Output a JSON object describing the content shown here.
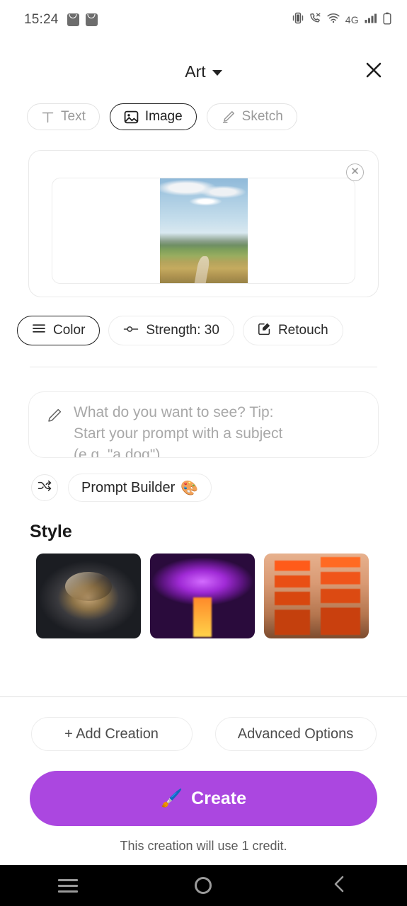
{
  "status_bar": {
    "time": "15:24",
    "left_icons": [
      "mail-bag-icon",
      "mail-bag-icon"
    ],
    "network_label": "4G",
    "right_icons": [
      "vibrate-icon",
      "call-mute-icon",
      "wifi-icon",
      "signal-bars-icon",
      "battery-icon"
    ]
  },
  "header": {
    "title": "Art",
    "dropdown_icon": "chevron-down-icon",
    "close_icon": "close-icon"
  },
  "modes": [
    {
      "label": "Text",
      "icon": "text-t-icon",
      "active": false
    },
    {
      "label": "Image",
      "icon": "image-icon",
      "active": true
    },
    {
      "label": "Sketch",
      "icon": "pencil-icon",
      "active": false
    }
  ],
  "image_card": {
    "remove_icon": "remove-circle-icon",
    "photo_alt": "landscape-photo"
  },
  "tools": [
    {
      "label": "Color",
      "icon": "sliders-lines-icon",
      "active": true
    },
    {
      "label": "Strength: 30",
      "icon": "slider-knob-icon",
      "active": false
    },
    {
      "label": "Retouch",
      "icon": "edit-square-icon",
      "active": false
    }
  ],
  "prompt": {
    "icon": "pencil-icon",
    "placeholder_line1": "What do you want to see? Tip:",
    "placeholder_line2": "Start your prompt with a subject",
    "placeholder_line3": "(e.g. \"a dog\")",
    "value": ""
  },
  "prompt_builder": {
    "shuffle_icon": "shuffle-icon",
    "label": "Prompt Builder",
    "emoji": "🎨"
  },
  "style": {
    "heading": "Style",
    "thumbnails": [
      {
        "name": "astronaut-helmet-style"
      },
      {
        "name": "glowing-mushroom-style"
      },
      {
        "name": "pagoda-temple-style"
      }
    ]
  },
  "actions": {
    "add_creation": "+ Add Creation",
    "advanced_options": "Advanced Options",
    "create_label": "Create",
    "create_emoji": "🖌️",
    "create_color": "#ab47e0",
    "credit_note": "This creation will use 1 credit."
  },
  "navbar": {
    "recents_icon": "menu-icon",
    "home_icon": "home-circle-icon",
    "back_icon": "chevron-left-icon"
  }
}
